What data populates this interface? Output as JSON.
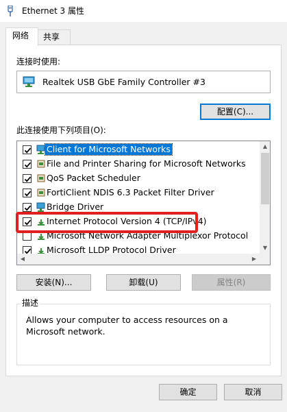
{
  "window": {
    "title": "Ethernet 3 属性"
  },
  "tabs": [
    {
      "label": "网络",
      "active": true
    },
    {
      "label": "共享",
      "active": false
    }
  ],
  "connect_using": {
    "label": "连接时使用:",
    "adapter": "Realtek USB GbE Family Controller #3",
    "configure_label": "配置(C)..."
  },
  "components": {
    "label": "此连接使用下列项目(O):",
    "items": [
      {
        "label": "Client for Microsoft Networks",
        "checked": true,
        "selected": true,
        "icon": "network-client-icon"
      },
      {
        "label": "File and Printer Sharing for Microsoft Networks",
        "checked": true,
        "selected": false,
        "icon": "network-service-icon"
      },
      {
        "label": "QoS Packet Scheduler",
        "checked": true,
        "selected": false,
        "icon": "network-service-icon"
      },
      {
        "label": "FortiClient NDIS 6.3 Packet Filter Driver",
        "checked": true,
        "selected": false,
        "icon": "network-service-icon"
      },
      {
        "label": "Bridge Driver",
        "checked": true,
        "selected": false,
        "icon": "network-client-icon"
      },
      {
        "label": "Internet Protocol Version 4 (TCP/IPv4)",
        "checked": true,
        "selected": false,
        "icon": "protocol-icon"
      },
      {
        "label": "Microsoft Network Adapter Multiplexor Protocol",
        "checked": false,
        "selected": false,
        "icon": "protocol-icon"
      },
      {
        "label": "Microsoft LLDP Protocol Driver",
        "checked": true,
        "selected": false,
        "icon": "protocol-icon"
      }
    ]
  },
  "buttons": {
    "install": "安装(N)...",
    "uninstall": "卸载(U)",
    "properties": "属性(R)",
    "ok": "确定",
    "cancel": "取消"
  },
  "description": {
    "title": "描述",
    "text": "Allows your computer to access resources on a Microsoft network."
  },
  "colors": {
    "selection": "#0078d7",
    "highlight_box": "#e02020",
    "dialog_bg": "#f0f0f0"
  }
}
